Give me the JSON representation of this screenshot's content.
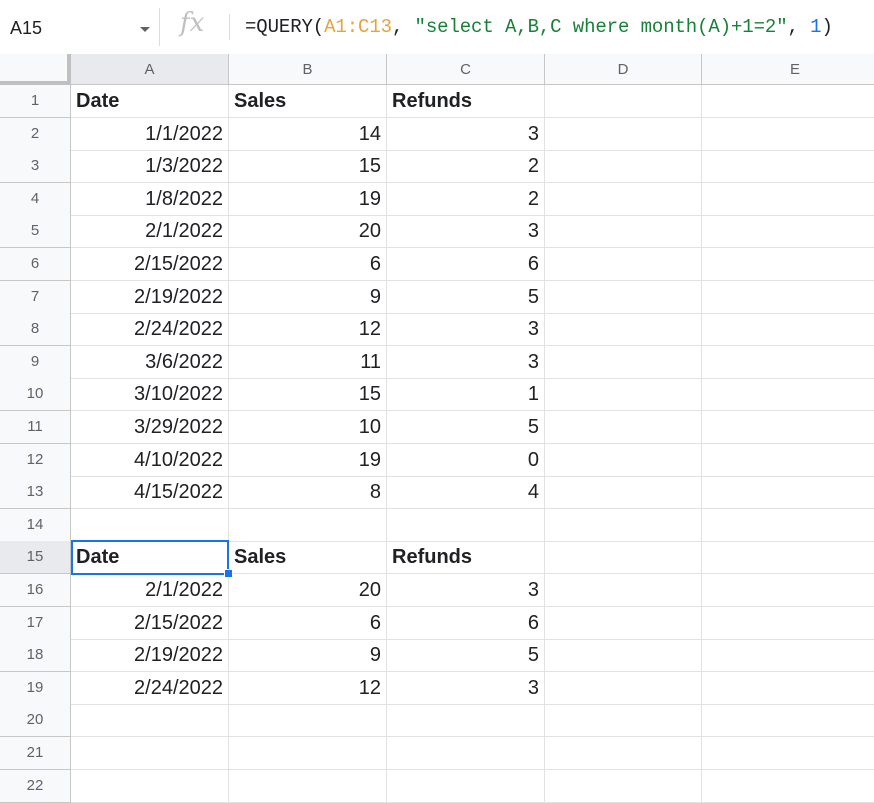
{
  "name_box": {
    "value": "A15"
  },
  "formula_bar": {
    "fx_label": "fx",
    "formula_parts": [
      {
        "text": "=QUERY(",
        "kind": "plain"
      },
      {
        "text": "A1:C13",
        "kind": "range"
      },
      {
        "text": ", ",
        "kind": "plain"
      },
      {
        "text": "\"select A,B,C where month(A)+1=2\"",
        "kind": "string"
      },
      {
        "text": ", ",
        "kind": "plain"
      },
      {
        "text": "1",
        "kind": "number"
      },
      {
        "text": ")",
        "kind": "plain"
      }
    ]
  },
  "colors": {
    "selection": "#1a73e8",
    "range_ref": "#e8a33d",
    "string_literal": "#188038",
    "number_literal": "#1a73e8"
  },
  "sheet": {
    "columns": [
      "A",
      "B",
      "C",
      "D",
      "E"
    ],
    "active_column": "A",
    "active_row": 15,
    "selected_cell": "A15",
    "rows": [
      {
        "num": "1",
        "cells": [
          "Date",
          "Sales",
          "Refunds"
        ],
        "bold": true
      },
      {
        "num": "2",
        "cells": [
          "1/1/2022",
          "14",
          "3"
        ]
      },
      {
        "num": "3",
        "cells": [
          "1/3/2022",
          "15",
          "2"
        ]
      },
      {
        "num": "4",
        "cells": [
          "1/8/2022",
          "19",
          "2"
        ]
      },
      {
        "num": "5",
        "cells": [
          "2/1/2022",
          "20",
          "3"
        ]
      },
      {
        "num": "6",
        "cells": [
          "2/15/2022",
          "6",
          "6"
        ]
      },
      {
        "num": "7",
        "cells": [
          "2/19/2022",
          "9",
          "5"
        ]
      },
      {
        "num": "8",
        "cells": [
          "2/24/2022",
          "12",
          "3"
        ]
      },
      {
        "num": "9",
        "cells": [
          "3/6/2022",
          "11",
          "3"
        ]
      },
      {
        "num": "10",
        "cells": [
          "3/10/2022",
          "15",
          "1"
        ]
      },
      {
        "num": "11",
        "cells": [
          "3/29/2022",
          "10",
          "5"
        ]
      },
      {
        "num": "12",
        "cells": [
          "4/10/2022",
          "19",
          "0"
        ]
      },
      {
        "num": "13",
        "cells": [
          "4/15/2022",
          "8",
          "4"
        ]
      },
      {
        "num": "14",
        "cells": [
          "",
          "",
          ""
        ]
      },
      {
        "num": "15",
        "cells": [
          "Date",
          "Sales",
          "Refunds"
        ],
        "bold": true
      },
      {
        "num": "16",
        "cells": [
          "2/1/2022",
          "20",
          "3"
        ]
      },
      {
        "num": "17",
        "cells": [
          "2/15/2022",
          "6",
          "6"
        ]
      },
      {
        "num": "18",
        "cells": [
          "2/19/2022",
          "9",
          "5"
        ]
      },
      {
        "num": "19",
        "cells": [
          "2/24/2022",
          "12",
          "3"
        ]
      },
      {
        "num": "20",
        "cells": [
          "",
          "",
          ""
        ]
      },
      {
        "num": "21",
        "cells": [
          "",
          "",
          ""
        ]
      },
      {
        "num": "22",
        "cells": [
          "",
          "",
          ""
        ]
      }
    ]
  }
}
